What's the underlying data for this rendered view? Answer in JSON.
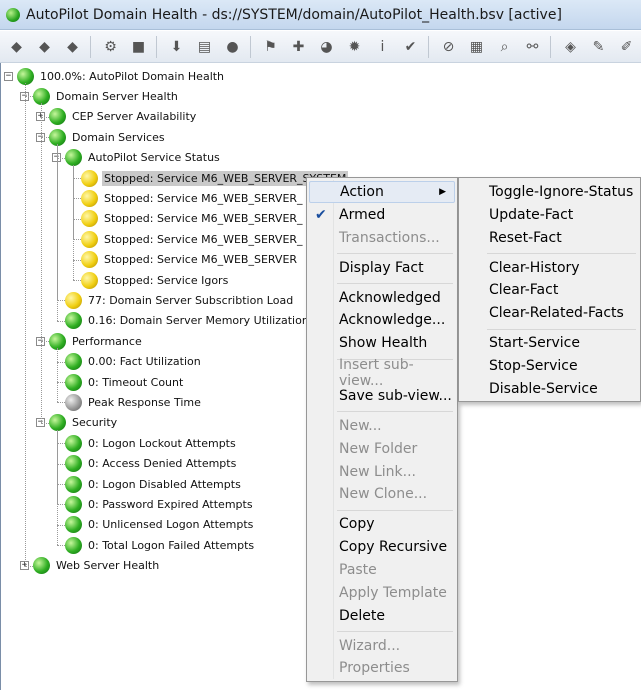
{
  "window": {
    "title": "AutoPilot Domain Health - ds://SYSTEM/domain/AutoPilot_Health.bsv [active]"
  },
  "toolbar": {
    "buttons": [
      {
        "icon": "gray-diamond-icon",
        "glyph": "◆"
      },
      {
        "icon": "gray-diamond-icon",
        "glyph": "◆"
      },
      {
        "icon": "gray-diamond-icon",
        "glyph": "◆"
      },
      {
        "icon": "wrench-box-icon",
        "glyph": "⚙"
      },
      {
        "icon": "stop-icon",
        "glyph": "■"
      },
      {
        "icon": "down-arrow-icon",
        "glyph": "⬇"
      },
      {
        "icon": "tree-view-icon",
        "glyph": "▤"
      },
      {
        "icon": "globe-icon",
        "glyph": "●"
      },
      {
        "icon": "flag-icon",
        "glyph": "⚑"
      },
      {
        "icon": "tools-icon",
        "glyph": "✚"
      },
      {
        "icon": "pie-chart-icon",
        "glyph": "◕"
      },
      {
        "icon": "alert-icon",
        "glyph": "✹"
      },
      {
        "icon": "info-icon",
        "glyph": "i"
      },
      {
        "icon": "check-icon",
        "glyph": "✔"
      },
      {
        "icon": "link-icon",
        "glyph": "⊘"
      },
      {
        "icon": "calendar-icon",
        "glyph": "▦"
      },
      {
        "icon": "search-icon",
        "glyph": "⌕"
      },
      {
        "icon": "network-icon",
        "glyph": "⚯"
      },
      {
        "icon": "tag-icon",
        "glyph": "◈"
      },
      {
        "icon": "pen-icon",
        "glyph": "✎"
      },
      {
        "icon": "pencil-icon",
        "glyph": "✐"
      }
    ]
  },
  "tree": {
    "nodes": [
      {
        "label": "100.0%: AutoPilot Domain Health",
        "status": "green",
        "expander": "−"
      },
      {
        "label": "Domain Server Health",
        "status": "green",
        "expander": "−"
      },
      {
        "label": "CEP Server Availability",
        "status": "green",
        "expander": "+"
      },
      {
        "label": "Domain Services",
        "status": "green",
        "expander": "−"
      },
      {
        "label": "AutoPilot Service Status",
        "status": "green",
        "expander": "−"
      },
      {
        "label": "Stopped: Service M6_WEB_SERVER_SYSTEM",
        "status": "yellow",
        "expander": ""
      },
      {
        "label": "Stopped: Service M6_WEB_SERVER_",
        "status": "yellow",
        "expander": ""
      },
      {
        "label": "Stopped: Service M6_WEB_SERVER_",
        "status": "yellow",
        "expander": ""
      },
      {
        "label": "Stopped: Service M6_WEB_SERVER_",
        "status": "yellow",
        "expander": ""
      },
      {
        "label": "Stopped: Service M6_WEB_SERVER",
        "status": "yellow",
        "expander": ""
      },
      {
        "label": "Stopped: Service Igors",
        "status": "yellow",
        "expander": ""
      },
      {
        "label": "77: Domain Server Subscribtion Load",
        "status": "yellow",
        "expander": ""
      },
      {
        "label": "0.16: Domain Server Memory Utilization",
        "status": "green",
        "expander": ""
      },
      {
        "label": "Performance",
        "status": "green",
        "expander": "−"
      },
      {
        "label": "0.00: Fact Utilization",
        "status": "green",
        "expander": ""
      },
      {
        "label": "0: Timeout Count",
        "status": "green",
        "expander": ""
      },
      {
        "label": "Peak Response Time",
        "status": "gray",
        "expander": ""
      },
      {
        "label": "Security",
        "status": "green",
        "expander": "−"
      },
      {
        "label": "0: Logon Lockout Attempts",
        "status": "green",
        "expander": ""
      },
      {
        "label": "0: Access Denied Attempts",
        "status": "green",
        "expander": ""
      },
      {
        "label": "0: Logon Disabled Attempts",
        "status": "green",
        "expander": ""
      },
      {
        "label": "0: Password Expired Attempts",
        "status": "green",
        "expander": ""
      },
      {
        "label": "0: Unlicensed Logon Attempts",
        "status": "green",
        "expander": ""
      },
      {
        "label": "0: Total Logon Failed Attempts",
        "status": "green",
        "expander": ""
      },
      {
        "label": "Web Server Health",
        "status": "green",
        "expander": "+"
      }
    ]
  },
  "context_menu": {
    "items": [
      {
        "label": "Action",
        "enabled": true,
        "submenu": true,
        "highlighted": true
      },
      {
        "label": "Armed",
        "enabled": true,
        "checked": true
      },
      {
        "label": "Transactions...",
        "enabled": false
      },
      {
        "sep": true
      },
      {
        "label": "Display Fact",
        "enabled": true
      },
      {
        "sep": true
      },
      {
        "label": "Acknowledged",
        "enabled": true
      },
      {
        "label": "Acknowledge...",
        "enabled": true
      },
      {
        "label": "Show Health",
        "enabled": true
      },
      {
        "sep": true
      },
      {
        "label": "Insert sub-view...",
        "enabled": false
      },
      {
        "label": "Save sub-view...",
        "enabled": true
      },
      {
        "sep": true
      },
      {
        "label": "New...",
        "enabled": false
      },
      {
        "label": "New Folder",
        "enabled": false
      },
      {
        "label": "New Link...",
        "enabled": false
      },
      {
        "label": "New Clone...",
        "enabled": false
      },
      {
        "sep": true
      },
      {
        "label": "Copy",
        "enabled": true
      },
      {
        "label": "Copy Recursive",
        "enabled": true
      },
      {
        "label": "Paste",
        "enabled": false
      },
      {
        "label": "Apply Template",
        "enabled": false
      },
      {
        "label": "Delete",
        "enabled": true
      },
      {
        "sep": true
      },
      {
        "label": "Wizard...",
        "enabled": false
      },
      {
        "label": "Properties",
        "enabled": false
      }
    ]
  },
  "action_submenu": {
    "items": [
      {
        "label": "Toggle-Ignore-Status",
        "enabled": true
      },
      {
        "label": "Update-Fact",
        "enabled": true
      },
      {
        "label": "Reset-Fact",
        "enabled": true
      },
      {
        "sep": true
      },
      {
        "label": "Clear-History",
        "enabled": true
      },
      {
        "label": "Clear-Fact",
        "enabled": true
      },
      {
        "label": "Clear-Related-Facts",
        "enabled": true
      },
      {
        "sep": true
      },
      {
        "label": "Start-Service",
        "enabled": true
      },
      {
        "label": "Stop-Service",
        "enabled": true
      },
      {
        "label": "Disable-Service",
        "enabled": true
      }
    ]
  },
  "colors": {
    "status_green": "#2fae22",
    "status_yellow": "#f0cf12",
    "status_gray": "#9a9a9a",
    "selection": "#c9c9c9"
  }
}
